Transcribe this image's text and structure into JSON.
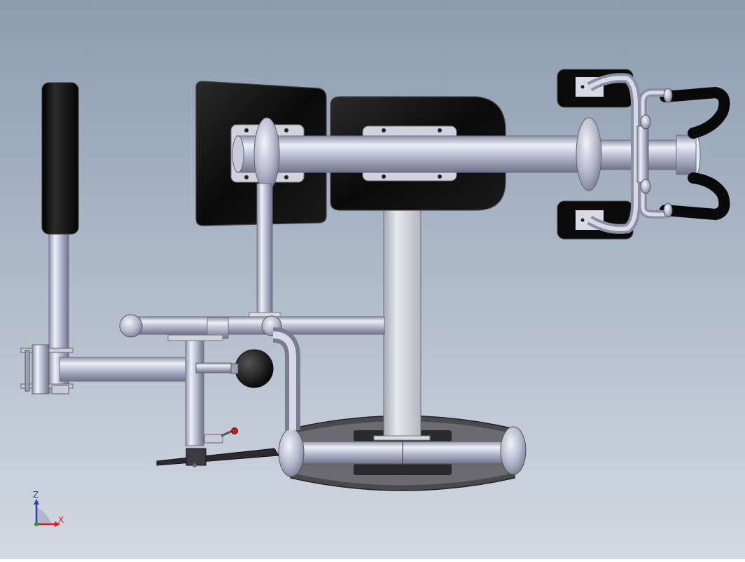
{
  "viewport": {
    "background_top": "#8c9cb0",
    "background_bottom": "#d3d9e2"
  },
  "colors": {
    "tube_light": "#eef0f8",
    "tube_mid": "#b6b9ce",
    "tube_dark": "#7a7d92",
    "pad": "#0d0d0d",
    "pad_edge": "#2a2a2a",
    "plate": "#c8cad8",
    "axis_z": "#1f3fd8",
    "axis_x": "#d22020",
    "axis_origin": "#20a030",
    "knob_red": "#cc1a1a"
  },
  "triad": {
    "z_label": "Z",
    "x_label": "X"
  }
}
